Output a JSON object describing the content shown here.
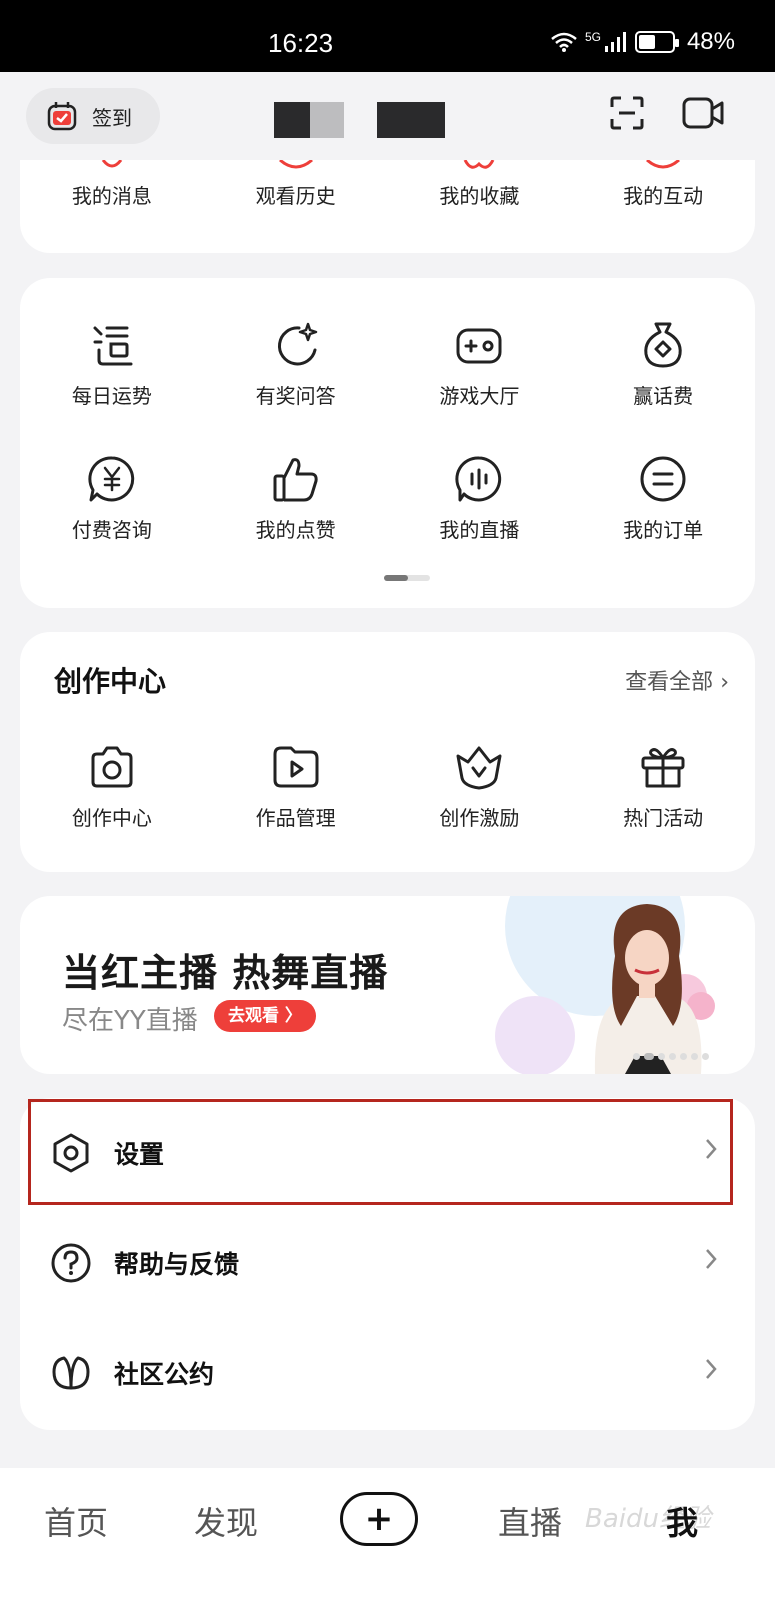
{
  "status_bar": {
    "time": "16:23",
    "network": "5G",
    "battery": "48%"
  },
  "top_bar": {
    "checkin_label": "签到"
  },
  "quick_access": {
    "items": [
      {
        "label": "我的消息",
        "icon": "message-icon"
      },
      {
        "label": "观看历史",
        "icon": "history-icon"
      },
      {
        "label": "我的收藏",
        "icon": "favorite-icon"
      },
      {
        "label": "我的互动",
        "icon": "interaction-icon"
      }
    ]
  },
  "services": {
    "row1": [
      {
        "label": "每日运势",
        "icon": "fortune-icon"
      },
      {
        "label": "有奖问答",
        "icon": "quiz-icon"
      },
      {
        "label": "游戏大厅",
        "icon": "gamepad-icon"
      },
      {
        "label": "赢话费",
        "icon": "money-bag-icon"
      }
    ],
    "row2": [
      {
        "label": "付费咨询",
        "icon": "paid-consult-icon"
      },
      {
        "label": "我的点赞",
        "icon": "thumbs-up-icon"
      },
      {
        "label": "我的直播",
        "icon": "live-icon"
      },
      {
        "label": "我的订单",
        "icon": "order-icon"
      }
    ]
  },
  "creation": {
    "title": "创作中心",
    "more": "查看全部",
    "items": [
      {
        "label": "创作中心",
        "icon": "camera-icon"
      },
      {
        "label": "作品管理",
        "icon": "video-folder-icon"
      },
      {
        "label": "创作激励",
        "icon": "crown-icon"
      },
      {
        "label": "热门活动",
        "icon": "gift-icon"
      }
    ]
  },
  "banner": {
    "title": "当红主播 热舞直播",
    "subtitle": "尽在YY直播",
    "button": "去观看 〉"
  },
  "menu": {
    "settings": "设置",
    "help": "帮助与反馈",
    "community": "社区公约"
  },
  "bottom_nav": {
    "home": "首页",
    "discover": "发现",
    "add": "+",
    "live": "直播",
    "me": "我"
  },
  "watermark": "Baidu经验",
  "colors": {
    "accent": "#ee3f3a",
    "highlight_border": "#b5261e",
    "background": "#f3f3f5"
  }
}
